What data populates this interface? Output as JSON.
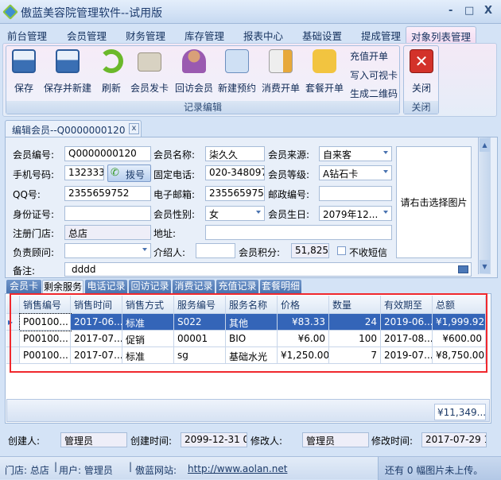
{
  "window": {
    "title": "傲蓝美容院管理软件--试用版",
    "minimize": "-",
    "maximize": "□",
    "close": "X"
  },
  "menu": {
    "tabs": [
      "前台管理",
      "会员管理",
      "财务管理",
      "库存管理",
      "报表中心",
      "基础设置",
      "提成管理",
      "对象列表管理"
    ],
    "active": "对象列表管理"
  },
  "ribbon": {
    "buttons": [
      {
        "label": "保存",
        "icon": "save-icon"
      },
      {
        "label": "保存并新建",
        "icon": "save-new-icon"
      },
      {
        "label": "刷新",
        "icon": "refresh-icon"
      },
      {
        "label": "会员发卡",
        "icon": "card-add-icon"
      },
      {
        "label": "回访会员",
        "icon": "visit-icon"
      },
      {
        "label": "新建预约",
        "icon": "appointment-icon"
      },
      {
        "label": "消费开单",
        "icon": "bill-icon"
      },
      {
        "label": "套餐开单",
        "icon": "package-icon"
      }
    ],
    "small": [
      "充值开单",
      "写入可视卡",
      "生成二维码"
    ],
    "group1": "记录编辑",
    "close_label": "关闭",
    "group2": "关闭"
  },
  "doc_tab": {
    "title": "编辑会员--Q0000000120",
    "close": "x"
  },
  "form": {
    "member_no_label": "会员编号:",
    "member_no": "Q0000000120",
    "name_label": "会员名称:",
    "name": "柒久久",
    "source_label": "会员来源:",
    "source": "自来客",
    "mobile_label": "手机号码:",
    "mobile": "1323333",
    "dial": "拨号",
    "phone_label": "固定电话:",
    "phone": "020-34809788",
    "level_label": "会员等级:",
    "level": "A钻石卡",
    "qq_label": "QQ号:",
    "qq": "2355659752",
    "email_label": "电子邮箱:",
    "email": "2355659752",
    "zip_label": "邮政编号:",
    "zip": "",
    "id_label": "身份证号:",
    "id": "",
    "gender_label": "会员性别:",
    "gender": "女",
    "birthday_label": "会员生日:",
    "birthday": "2079年12...",
    "store_label": "注册门店:",
    "store": "总店",
    "address_label": "地址:",
    "address": "",
    "advisor_label": "负责顾问:",
    "advisor": "",
    "referrer_label": "介绍人:",
    "referrer": "",
    "points_label": "会员积分:",
    "points": "51,825.",
    "no_sms": "不收短信",
    "no_sms_checked": false,
    "note_label": "备注:",
    "note": "dddd",
    "picture": "请右击选择图片"
  },
  "subtabs": {
    "items": [
      "会员卡",
      "剩余服务",
      "电话记录",
      "回访记录",
      "消费记录",
      "充值记录",
      "套餐明细"
    ],
    "active": "剩余服务"
  },
  "grid": {
    "columns": [
      "销售编号",
      "销售时间",
      "销售方式",
      "服务编号",
      "服务名称",
      "价格",
      "数量",
      "有效期至",
      "总额"
    ],
    "rows": [
      [
        "P00100...",
        "2017-06...",
        "标准",
        "S022",
        "其他",
        "¥83.33",
        "24",
        "2019-06...",
        "¥1,999.92"
      ],
      [
        "P00100...",
        "2017-07...",
        "促销",
        "00001",
        "BIO",
        "¥6.00",
        "100",
        "2017-08...",
        "¥600.00"
      ],
      [
        "P00100...",
        "2017-07...",
        "标准",
        "sg",
        "基础水光",
        "¥1,250.00",
        "7",
        "2019-07...",
        "¥8,750.00"
      ]
    ],
    "selected_row": 0,
    "total": "¥11,349...."
  },
  "audit": {
    "creator_label": "创建人:",
    "creator": "管理员",
    "created_label": "创建时间:",
    "created": "2099-12-31 09",
    "modifier_label": "修改人:",
    "modifier": "管理员",
    "modified_label": "修改时间:",
    "modified": "2017-07-29 16"
  },
  "status": {
    "store": "门店: 总店",
    "user": "用户: 管理员",
    "site_label": "傲蓝网站:",
    "site": "http://www.aolan.net",
    "upload": "还有 0 幅图片未上传。"
  }
}
